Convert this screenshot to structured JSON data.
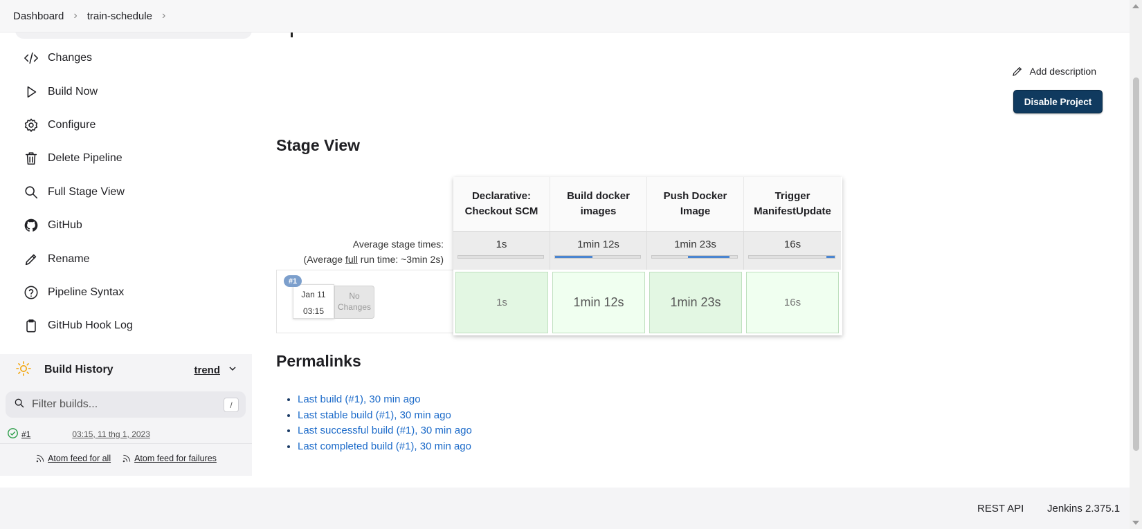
{
  "breadcrumb": {
    "items": [
      "Dashboard",
      "train-schedule"
    ]
  },
  "sidebar": {
    "items": [
      {
        "label": "Changes",
        "icon": "code-icon"
      },
      {
        "label": "Build Now",
        "icon": "play-icon"
      },
      {
        "label": "Configure",
        "icon": "gear-icon"
      },
      {
        "label": "Delete Pipeline",
        "icon": "trash-icon"
      },
      {
        "label": "Full Stage View",
        "icon": "search-icon"
      },
      {
        "label": "GitHub",
        "icon": "github-icon"
      },
      {
        "label": "Rename",
        "icon": "pencil-icon"
      },
      {
        "label": "Pipeline Syntax",
        "icon": "help-circle-icon"
      },
      {
        "label": "GitHub Hook Log",
        "icon": "clipboard-icon"
      }
    ]
  },
  "build_history": {
    "title": "Build History",
    "trend": "trend",
    "filter_placeholder": "Filter builds...",
    "filter_shortcut": "/",
    "builds": [
      {
        "number": "#1",
        "date": "03:15, 11 thg 1, 2023",
        "status": "success"
      }
    ],
    "feed_all": "Atom feed for all",
    "feed_failures": "Atom feed for failures"
  },
  "main": {
    "add_description": "Add description",
    "disable_button": "Disable Project",
    "stage_view_title": "Stage View",
    "permalinks_title": "Permalinks"
  },
  "stage_view": {
    "avg_label": "Average stage times:",
    "avg_full_prefix": "(Average ",
    "avg_full_word": "full",
    "avg_full_suffix": " run time: ~3min 2s)",
    "run": {
      "badge": "#1",
      "date": "Jan 11",
      "time": "03:15",
      "changes_line1": "No",
      "changes_line2": "Changes"
    },
    "stages": [
      {
        "name_line1": "Declarative:",
        "name_line2": "Checkout SCM",
        "avg": "1s",
        "bar_start": 0,
        "bar_end": 0,
        "result": "1s"
      },
      {
        "name_line1": "Build docker",
        "name_line2": "images",
        "avg": "1min 12s",
        "bar_start": 0,
        "bar_end": 0.44,
        "result": "1min 12s"
      },
      {
        "name_line1": "Push Docker",
        "name_line2": "Image",
        "avg": "1min 23s",
        "bar_start": 0.42,
        "bar_end": 0.91,
        "result": "1min 23s"
      },
      {
        "name_line1": "Trigger",
        "name_line2": "ManifestUpdate",
        "avg": "16s",
        "bar_start": 0.9,
        "bar_end": 1.0,
        "result": "16s"
      }
    ]
  },
  "permalinks": [
    "Last build (#1), 30 min ago",
    "Last stable build (#1), 30 min ago",
    "Last successful build (#1), 30 min ago",
    "Last completed build (#1), 30 min ago"
  ],
  "footer": {
    "rest_api": "REST API",
    "version": "Jenkins 2.375.1"
  },
  "colors": {
    "primary_button": "#103a5f",
    "link": "#1b6ac9",
    "success_cell": "#e3f7e3",
    "success_cell_alt": "#f0fff0",
    "progress": "#4a85d0",
    "success_icon": "#2e9e4a",
    "sun_icon": "#f2a50c"
  }
}
